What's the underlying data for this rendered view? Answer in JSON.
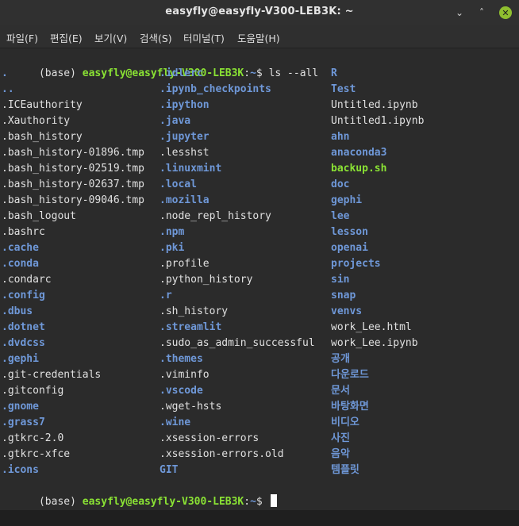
{
  "window": {
    "title": "easyfly@easyfly-V300-LEB3K: ~",
    "minimize_glyph": "⌄",
    "maximize_glyph": "˄",
    "close_glyph": "✕"
  },
  "menubar": [
    "파일(F)",
    "편집(E)",
    "보기(V)",
    "검색(S)",
    "터미널(T)",
    "도움말(H)"
  ],
  "prompt": {
    "env": "(base) ",
    "userhost": "easyfly@easyfly-V300-LEB3K",
    "sep": ":",
    "path": "~",
    "dollar": "$ ",
    "command": "ls --all"
  },
  "listing": {
    "columns": [
      [
        {
          "name": ".",
          "type": "dir"
        },
        {
          "name": "..",
          "type": "dir"
        },
        {
          "name": ".ICEauthority",
          "type": "file"
        },
        {
          "name": ".Xauthority",
          "type": "file"
        },
        {
          "name": ".bash_history",
          "type": "file"
        },
        {
          "name": ".bash_history-01896.tmp",
          "type": "file"
        },
        {
          "name": ".bash_history-02519.tmp",
          "type": "file"
        },
        {
          "name": ".bash_history-02637.tmp",
          "type": "file"
        },
        {
          "name": ".bash_history-09046.tmp",
          "type": "file"
        },
        {
          "name": ".bash_logout",
          "type": "file"
        },
        {
          "name": ".bashrc",
          "type": "file"
        },
        {
          "name": ".cache",
          "type": "dir"
        },
        {
          "name": ".conda",
          "type": "dir"
        },
        {
          "name": ".condarc",
          "type": "file"
        },
        {
          "name": ".config",
          "type": "dir"
        },
        {
          "name": ".dbus",
          "type": "dir"
        },
        {
          "name": ".dotnet",
          "type": "dir"
        },
        {
          "name": ".dvdcss",
          "type": "dir"
        },
        {
          "name": ".gephi",
          "type": "dir"
        },
        {
          "name": ".git-credentials",
          "type": "file"
        },
        {
          "name": ".gitconfig",
          "type": "file"
        },
        {
          "name": ".gnome",
          "type": "dir"
        },
        {
          "name": ".grass7",
          "type": "dir"
        },
        {
          "name": ".gtkrc-2.0",
          "type": "file"
        },
        {
          "name": ".gtkrc-xfce",
          "type": "file"
        },
        {
          "name": ".icons",
          "type": "dir"
        }
      ],
      [
        {
          "name": ".idlerc",
          "type": "dir"
        },
        {
          "name": ".ipynb_checkpoints",
          "type": "dir"
        },
        {
          "name": ".ipython",
          "type": "dir"
        },
        {
          "name": ".java",
          "type": "dir"
        },
        {
          "name": ".jupyter",
          "type": "dir"
        },
        {
          "name": ".lesshst",
          "type": "file"
        },
        {
          "name": ".linuxmint",
          "type": "dir"
        },
        {
          "name": ".local",
          "type": "dir"
        },
        {
          "name": ".mozilla",
          "type": "dir"
        },
        {
          "name": ".node_repl_history",
          "type": "file"
        },
        {
          "name": ".npm",
          "type": "dir"
        },
        {
          "name": ".pki",
          "type": "dir"
        },
        {
          "name": ".profile",
          "type": "file"
        },
        {
          "name": ".python_history",
          "type": "file"
        },
        {
          "name": ".r",
          "type": "dir"
        },
        {
          "name": ".sh_history",
          "type": "file"
        },
        {
          "name": ".streamlit",
          "type": "dir"
        },
        {
          "name": ".sudo_as_admin_successful",
          "type": "file"
        },
        {
          "name": ".themes",
          "type": "dir"
        },
        {
          "name": ".viminfo",
          "type": "file"
        },
        {
          "name": ".vscode",
          "type": "dir"
        },
        {
          "name": ".wget-hsts",
          "type": "file"
        },
        {
          "name": ".wine",
          "type": "dir"
        },
        {
          "name": ".xsession-errors",
          "type": "file"
        },
        {
          "name": ".xsession-errors.old",
          "type": "file"
        },
        {
          "name": "GIT",
          "type": "dir"
        }
      ],
      [
        {
          "name": "R",
          "type": "dir"
        },
        {
          "name": "Test",
          "type": "dir"
        },
        {
          "name": "Untitled.ipynb",
          "type": "file"
        },
        {
          "name": "Untitled1.ipynb",
          "type": "file"
        },
        {
          "name": "ahn",
          "type": "dir"
        },
        {
          "name": "anaconda3",
          "type": "dir"
        },
        {
          "name": "backup.sh",
          "type": "exec"
        },
        {
          "name": "doc",
          "type": "dir"
        },
        {
          "name": "gephi",
          "type": "dir"
        },
        {
          "name": "lee",
          "type": "dir"
        },
        {
          "name": "lesson",
          "type": "dir"
        },
        {
          "name": "openai",
          "type": "dir"
        },
        {
          "name": "projects",
          "type": "dir"
        },
        {
          "name": "sin",
          "type": "dir"
        },
        {
          "name": "snap",
          "type": "dir"
        },
        {
          "name": "venvs",
          "type": "dir"
        },
        {
          "name": "work_Lee.html",
          "type": "file"
        },
        {
          "name": "work_Lee.ipynb",
          "type": "file"
        },
        {
          "name": "공개",
          "type": "dir"
        },
        {
          "name": "다운로드",
          "type": "dir"
        },
        {
          "name": "문서",
          "type": "dir"
        },
        {
          "name": "바탕화면",
          "type": "dir"
        },
        {
          "name": "비디오",
          "type": "dir"
        },
        {
          "name": "사진",
          "type": "dir"
        },
        {
          "name": "음악",
          "type": "dir"
        },
        {
          "name": "템플릿",
          "type": "dir"
        }
      ]
    ]
  },
  "colors": {
    "prompt_user": "#8ae234",
    "directory": "#6f98d8",
    "executable": "#8ae234",
    "text": "#e0e0e0",
    "background": "#2b2b2b",
    "close_button": "#8fbf2f"
  }
}
